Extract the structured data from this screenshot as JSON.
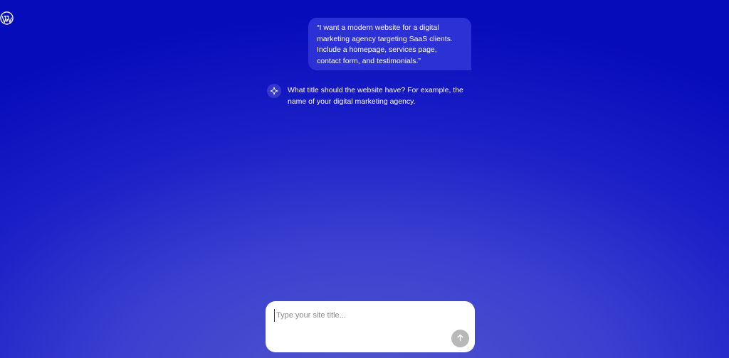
{
  "app": {
    "logo_icon": "wordpress-logo-icon"
  },
  "conversation": {
    "user_message": "“I want a modern website for a digital marketing agency targeting SaaS clients. Include a homepage, services page, contact form, and testimonials.”",
    "assistant_message": "What title should the website have? For example, the name of your digital marketing agency.",
    "assistant_icon": "sparkle-icon"
  },
  "composer": {
    "placeholder": "Type your site title...",
    "value": "",
    "send_icon": "arrow-up-icon"
  },
  "colors": {
    "background_top": "#070cbb",
    "background_glow": "#5057cb",
    "user_bubble": "#2c31d6",
    "send_button": "#b8b8b8"
  }
}
